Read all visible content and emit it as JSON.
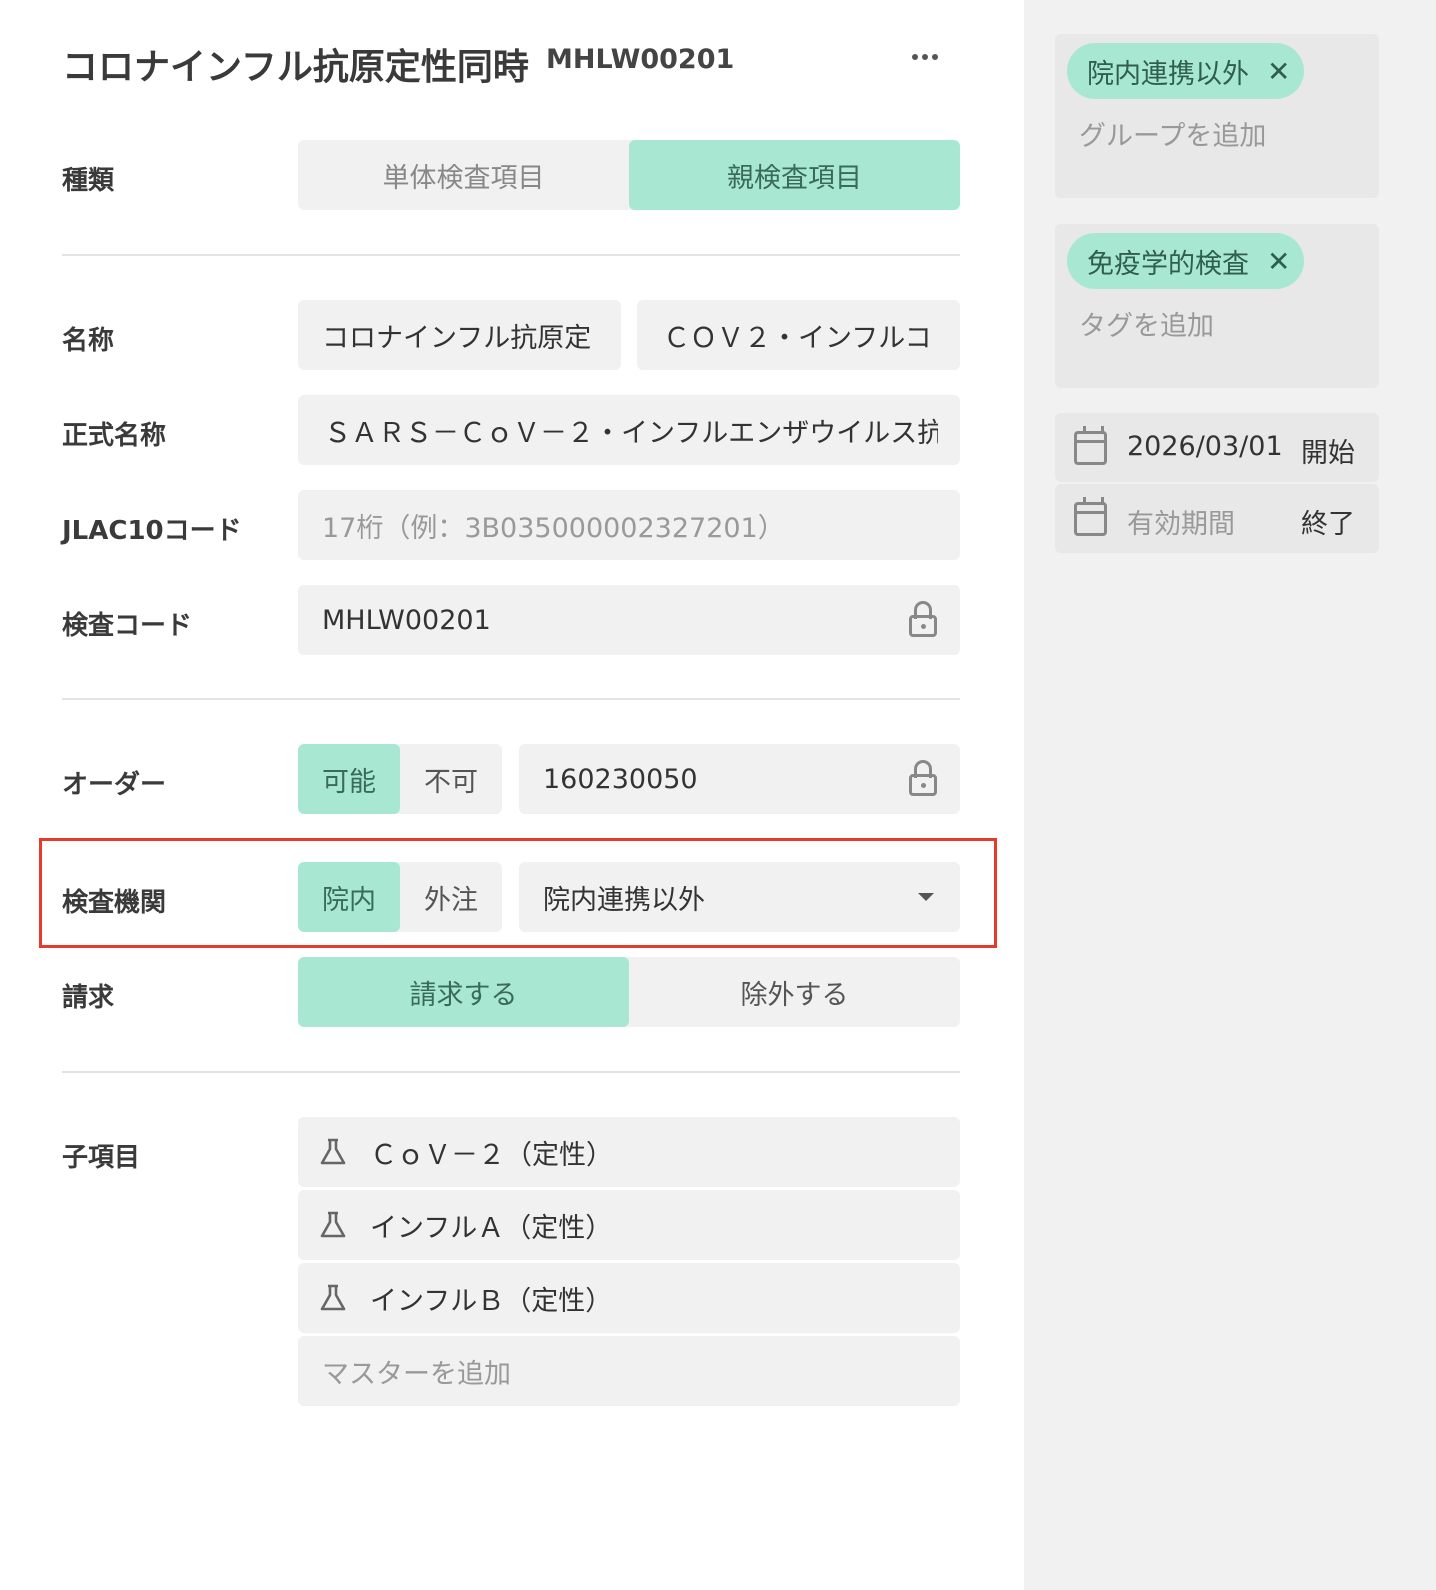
{
  "header": {
    "title": "コロナインフル抗原定性同時",
    "code": "MHLW00201"
  },
  "form": {
    "kind": {
      "label": "種類",
      "options": [
        "単体検査項目",
        "親検査項目"
      ],
      "selected": "親検査項目"
    },
    "name": {
      "label": "名称",
      "short": "コロナインフル抗原定",
      "abbr": "ＣＯＶ２・インフルコ"
    },
    "formal_name": {
      "label": "正式名称",
      "value": "ＳＡＲＳ－ＣｏＶ－２・インフルエンザウイルス抗"
    },
    "jlac10": {
      "label": "JLAC10コード",
      "placeholder": "17桁（例：3B035000002327201）"
    },
    "test_code": {
      "label": "検査コード",
      "value": "MHLW00201"
    },
    "order": {
      "label": "オーダー",
      "options": [
        "可能",
        "不可"
      ],
      "selected": "可能",
      "code": "160230050"
    },
    "lab": {
      "label": "検査機関",
      "options": [
        "院内",
        "外注"
      ],
      "selected": "院内",
      "dropdown_value": "院内連携以外"
    },
    "billing": {
      "label": "請求",
      "options": [
        "請求する",
        "除外する"
      ],
      "selected": "請求する"
    },
    "children": {
      "label": "子項目",
      "items": [
        "ＣｏＶ－２（定性）",
        "インフルＡ（定性）",
        "インフルＢ（定性）"
      ],
      "add_placeholder": "マスターを追加"
    }
  },
  "sidebar": {
    "group": {
      "chip": "院内連携以外",
      "add": "グループを追加"
    },
    "tag": {
      "chip": "免疫学的検査",
      "add": "タグを追加"
    },
    "start": {
      "date": "2026/03/01",
      "label": "開始"
    },
    "end": {
      "placeholder": "有効期間",
      "label": "終了"
    }
  },
  "colors": {
    "accent": "#a8e8d3",
    "highlight": "#e53b2c",
    "field_bg": "#f1f1f1",
    "sidebar_bg": "#f1f1f1"
  }
}
